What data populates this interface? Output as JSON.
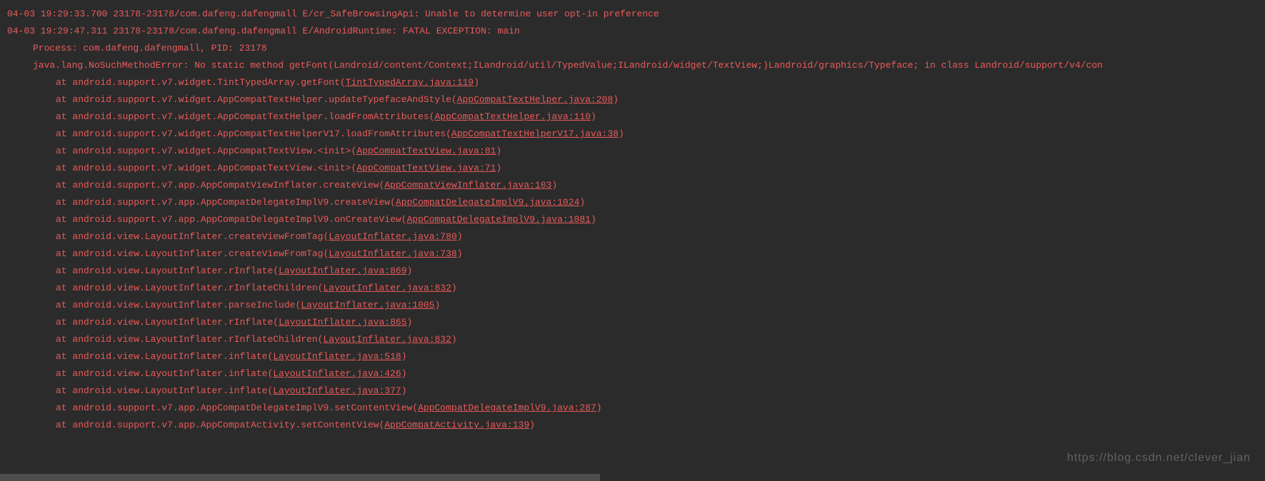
{
  "lines": [
    {
      "indent": 0,
      "prefix": "04-03 19:29:33.700 23178-23178/com.dafeng.dafengmall E/cr_SafeBrowsingApi: Unable to determine user opt-in preference",
      "link": "",
      "suffix": ""
    },
    {
      "indent": 0,
      "prefix": "04-03 19:29:47.311 23178-23178/com.dafeng.dafengmall E/AndroidRuntime: FATAL EXCEPTION: main",
      "link": "",
      "suffix": ""
    },
    {
      "indent": 1,
      "prefix": "Process: com.dafeng.dafengmall, PID: 23178",
      "link": "",
      "suffix": ""
    },
    {
      "indent": 1,
      "prefix": "java.lang.NoSuchMethodError: No static method getFont(Landroid/content/Context;ILandroid/util/TypedValue;ILandroid/widget/TextView;)Landroid/graphics/Typeface; in class Landroid/support/v4/con",
      "link": "",
      "suffix": ""
    },
    {
      "indent": 2,
      "prefix": "at android.support.v7.widget.TintTypedArray.getFont(",
      "link": "TintTypedArray.java:119",
      "suffix": ")"
    },
    {
      "indent": 2,
      "prefix": "at android.support.v7.widget.AppCompatTextHelper.updateTypefaceAndStyle(",
      "link": "AppCompatTextHelper.java:208",
      "suffix": ")"
    },
    {
      "indent": 2,
      "prefix": "at android.support.v7.widget.AppCompatTextHelper.loadFromAttributes(",
      "link": "AppCompatTextHelper.java:110",
      "suffix": ")"
    },
    {
      "indent": 2,
      "prefix": "at android.support.v7.widget.AppCompatTextHelperV17.loadFromAttributes(",
      "link": "AppCompatTextHelperV17.java:38",
      "suffix": ")"
    },
    {
      "indent": 2,
      "prefix": "at android.support.v7.widget.AppCompatTextView.<init>(",
      "link": "AppCompatTextView.java:81",
      "suffix": ")"
    },
    {
      "indent": 2,
      "prefix": "at android.support.v7.widget.AppCompatTextView.<init>(",
      "link": "AppCompatTextView.java:71",
      "suffix": ")"
    },
    {
      "indent": 2,
      "prefix": "at android.support.v7.app.AppCompatViewInflater.createView(",
      "link": "AppCompatViewInflater.java:103",
      "suffix": ")"
    },
    {
      "indent": 2,
      "prefix": "at android.support.v7.app.AppCompatDelegateImplV9.createView(",
      "link": "AppCompatDelegateImplV9.java:1024",
      "suffix": ")"
    },
    {
      "indent": 2,
      "prefix": "at android.support.v7.app.AppCompatDelegateImplV9.onCreateView(",
      "link": "AppCompatDelegateImplV9.java:1081",
      "suffix": ")"
    },
    {
      "indent": 2,
      "prefix": "at android.view.LayoutInflater.createViewFromTag(",
      "link": "LayoutInflater.java:780",
      "suffix": ")"
    },
    {
      "indent": 2,
      "prefix": "at android.view.LayoutInflater.createViewFromTag(",
      "link": "LayoutInflater.java:738",
      "suffix": ")"
    },
    {
      "indent": 2,
      "prefix": "at android.view.LayoutInflater.rInflate(",
      "link": "LayoutInflater.java:869",
      "suffix": ")"
    },
    {
      "indent": 2,
      "prefix": "at android.view.LayoutInflater.rInflateChildren(",
      "link": "LayoutInflater.java:832",
      "suffix": ")"
    },
    {
      "indent": 2,
      "prefix": "at android.view.LayoutInflater.parseInclude(",
      "link": "LayoutInflater.java:1005",
      "suffix": ")"
    },
    {
      "indent": 2,
      "prefix": "at android.view.LayoutInflater.rInflate(",
      "link": "LayoutInflater.java:865",
      "suffix": ")"
    },
    {
      "indent": 2,
      "prefix": "at android.view.LayoutInflater.rInflateChildren(",
      "link": "LayoutInflater.java:832",
      "suffix": ")"
    },
    {
      "indent": 2,
      "prefix": "at android.view.LayoutInflater.inflate(",
      "link": "LayoutInflater.java:518",
      "suffix": ")"
    },
    {
      "indent": 2,
      "prefix": "at android.view.LayoutInflater.inflate(",
      "link": "LayoutInflater.java:426",
      "suffix": ")"
    },
    {
      "indent": 2,
      "prefix": "at android.view.LayoutInflater.inflate(",
      "link": "LayoutInflater.java:377",
      "suffix": ")"
    },
    {
      "indent": 2,
      "prefix": "at android.support.v7.app.AppCompatDelegateImplV9.setContentView(",
      "link": "AppCompatDelegateImplV9.java:287",
      "suffix": ")"
    },
    {
      "indent": 2,
      "prefix": "at android.support.v7.app.AppCompatActivity.setContentView(",
      "link": "AppCompatActivity.java:139",
      "suffix": ")"
    }
  ],
  "watermark": "https://blog.csdn.net/clever_jian"
}
